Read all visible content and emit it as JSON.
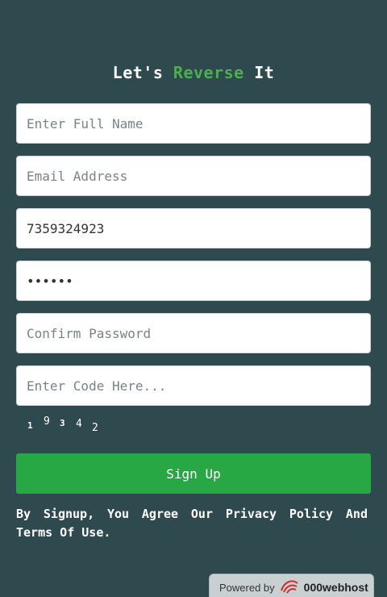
{
  "header": {
    "title_prefix": "Let's ",
    "title_accent": "Reverse",
    "title_suffix": " It"
  },
  "form": {
    "full_name": {
      "placeholder": "Enter Full Name",
      "value": ""
    },
    "email": {
      "placeholder": "Email Address",
      "value": ""
    },
    "phone": {
      "placeholder": "",
      "value": "7359324923"
    },
    "password": {
      "placeholder": "",
      "value": "••••••"
    },
    "confirm_password": {
      "placeholder": "Confirm Password",
      "value": ""
    },
    "code": {
      "placeholder": "Enter Code Here...",
      "value": ""
    },
    "captcha_digits": [
      "1",
      "9",
      "3",
      "4",
      "2"
    ],
    "submit_label": "Sign Up"
  },
  "terms_text": "By Signup, You Agree Our Privacy Policy And Terms Of Use.",
  "footer": {
    "powered_by": "Powered by",
    "brand": "000webhost"
  },
  "colors": {
    "background": "#2e4a4e",
    "accent": "#4caf50",
    "button": "#28a745"
  }
}
